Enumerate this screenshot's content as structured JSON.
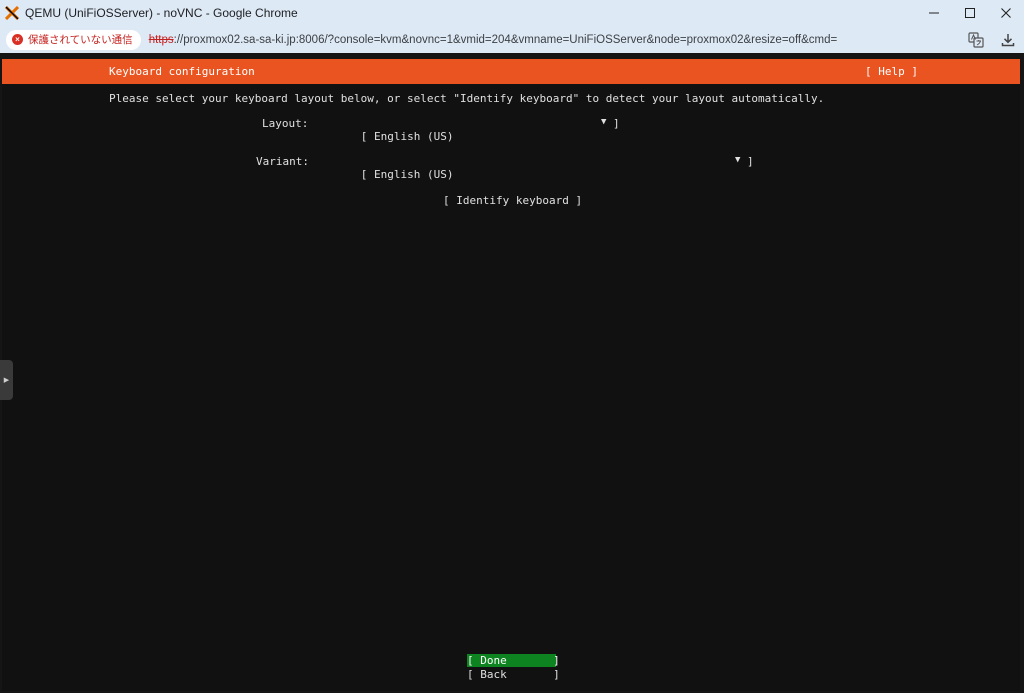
{
  "window": {
    "title": "QEMU (UniFiOSServer) - noVNC - Google Chrome",
    "controls": [
      "minimize",
      "maximize",
      "close"
    ]
  },
  "addressbar": {
    "security_label": "保護されていない通信",
    "url_scheme": "https",
    "url_rest": "://proxmox02.sa-sa-ki.jp:8006/?console=kvm&novnc=1&vmid=204&vmname=UniFiOSServer&node=proxmox02&resize=off&cmd="
  },
  "installer": {
    "header_title": "Keyboard configuration",
    "help_label": "[ Help ]",
    "instruction": "Please select your keyboard layout below, or select \"Identify keyboard\" to detect your layout automatically.",
    "layout_label": "Layout:",
    "layout_value": "[ English (US)",
    "layout_arrow": "▼",
    "layout_close": "]",
    "variant_label": "Variant:",
    "variant_value": "[ English (US)",
    "variant_arrow": "▼",
    "variant_close": "]",
    "identify_label": "[ Identify keyboard ]",
    "done_label": "[ Done       ]",
    "back_label": "[ Back       ]"
  },
  "colors": {
    "header_orange": "#e95420",
    "done_green": "#0e8420",
    "terminal_bg": "#111111"
  }
}
